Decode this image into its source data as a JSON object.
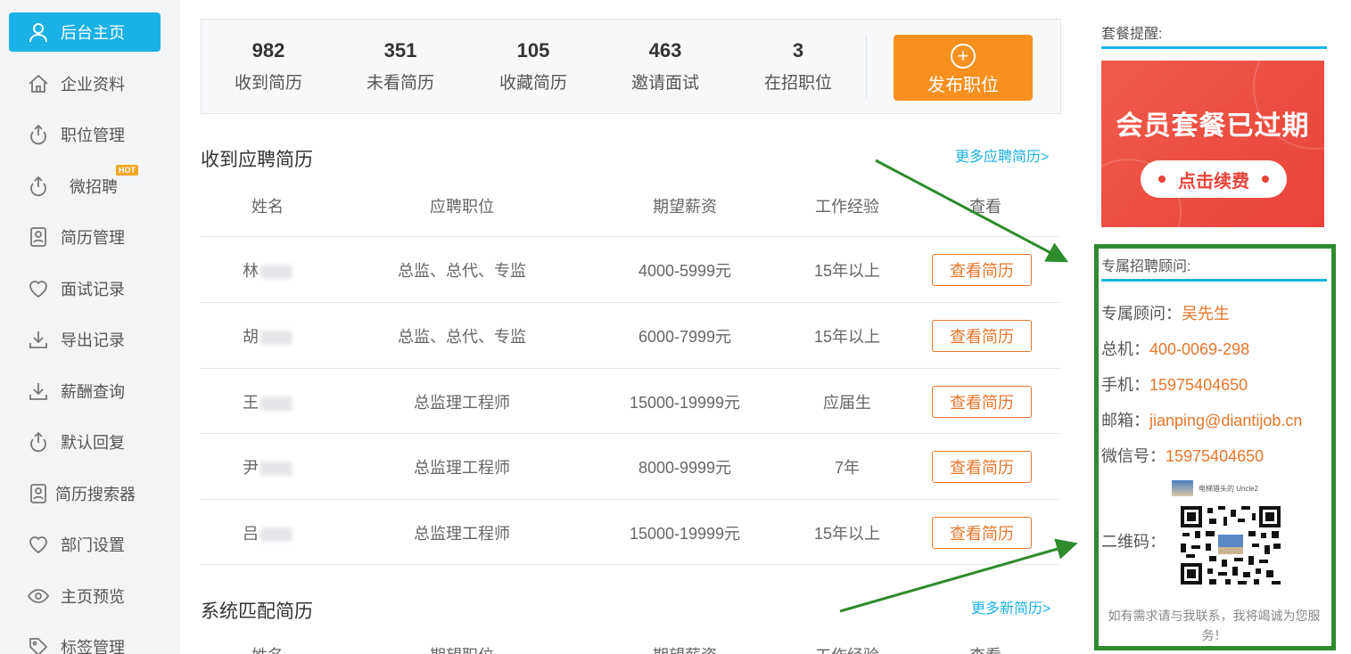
{
  "sidebar": {
    "items": [
      {
        "label": "后台主页",
        "icon": "user-icon",
        "active": true
      },
      {
        "label": "企业资料",
        "icon": "home-icon"
      },
      {
        "label": "职位管理",
        "icon": "upload-icon"
      },
      {
        "label": "微招聘",
        "icon": "upload-icon",
        "badge": "HOT"
      },
      {
        "label": "简历管理",
        "icon": "resume-icon"
      },
      {
        "label": "面试记录",
        "icon": "heart-icon"
      },
      {
        "label": "导出记录",
        "icon": "download-icon"
      },
      {
        "label": "薪酬查询",
        "icon": "download-icon"
      },
      {
        "label": "默认回复",
        "icon": "upload-icon"
      },
      {
        "label": "简历搜索器",
        "icon": "resume-icon"
      },
      {
        "label": "部门设置",
        "icon": "heart-icon"
      },
      {
        "label": "主页预览",
        "icon": "eye-icon"
      },
      {
        "label": "标签管理",
        "icon": "tag-icon"
      }
    ]
  },
  "stats": [
    {
      "num": "982",
      "label": "收到简历"
    },
    {
      "num": "351",
      "label": "未看简历"
    },
    {
      "num": "105",
      "label": "收藏简历"
    },
    {
      "num": "463",
      "label": "邀请面试"
    },
    {
      "num": "3",
      "label": "在招职位"
    }
  ],
  "publish_label": "发布职位",
  "received": {
    "title": "收到应聘简历",
    "more": "更多应聘简历>",
    "headers": [
      "姓名",
      "应聘职位",
      "期望薪资",
      "工作经验",
      "查看"
    ],
    "rows": [
      {
        "name": "林",
        "position": "总监、总代、专监",
        "salary": "4000-5999元",
        "exp": "15年以上",
        "action": "查看简历"
      },
      {
        "name": "胡",
        "position": "总监、总代、专监",
        "salary": "6000-7999元",
        "exp": "15年以上",
        "action": "查看简历"
      },
      {
        "name": "王",
        "position": "总监理工程师",
        "salary": "15000-19999元",
        "exp": "应届生",
        "action": "查看简历"
      },
      {
        "name": "尹",
        "position": "总监理工程师",
        "salary": "8000-9999元",
        "exp": "7年",
        "action": "查看简历"
      },
      {
        "name": "吕",
        "position": "总监理工程师",
        "salary": "15000-19999元",
        "exp": "15年以上",
        "action": "查看简历"
      }
    ]
  },
  "matched": {
    "title": "系统匹配简历",
    "more": "更多新简历>",
    "headers": [
      "姓名",
      "期望职位",
      "期望薪资",
      "工作经验",
      "查看"
    ]
  },
  "right": {
    "package_title": "套餐提醒:",
    "promo_text": "会员套餐已过期",
    "promo_button": "点击续费",
    "advisor_title": "专属招聘顾问:",
    "advisor": {
      "label": "专属顾问：",
      "value": "吴先生"
    },
    "phone": {
      "label": "总机：",
      "value": "400-0069-298"
    },
    "mobile": {
      "label": "手机：",
      "value": "15975404650"
    },
    "email": {
      "label": "邮箱：",
      "value": "jianping@diantijob.cn"
    },
    "wechat": {
      "label": "微信号：",
      "value": "15975404650"
    },
    "qr_label": "二维码：",
    "qr_header": "电梯猎头的 Uncle2",
    "footer": "如有需求请与我联系，我将竭诚为您服务！"
  },
  "colors": {
    "accent": "#1ab1e6",
    "orange": "#f7901e",
    "link_orange": "#e8762b",
    "green_annotation": "#2e8b2e",
    "promo_red": "#e9443a"
  }
}
